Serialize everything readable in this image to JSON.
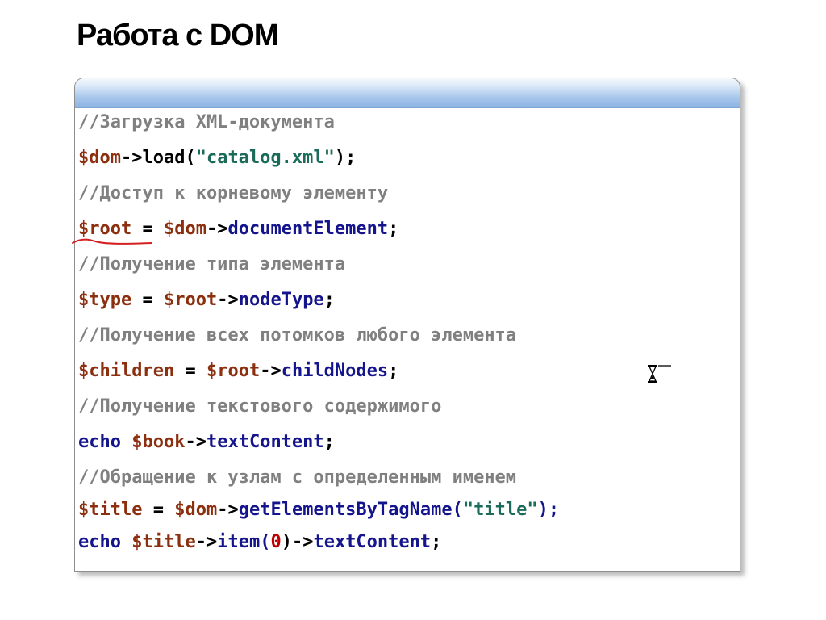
{
  "slide": {
    "title": "Работа с DOM"
  },
  "code": {
    "lines": [
      [
        {
          "t": "//Загрузка XML-документа",
          "k": "cm"
        }
      ],
      [
        {
          "t": "$dom",
          "k": "var"
        },
        {
          "t": "->load(",
          "k": "op"
        },
        {
          "t": "\"catalog.xml\"",
          "k": "str"
        },
        {
          "t": ");",
          "k": "op"
        }
      ],
      [
        {
          "t": "//Доступ к корневому элементу",
          "k": "cm"
        }
      ],
      [
        {
          "t": "$root",
          "k": "var"
        },
        {
          "t": " = ",
          "k": "op"
        },
        {
          "t": "$dom",
          "k": "var"
        },
        {
          "t": "->",
          "k": "op"
        },
        {
          "t": "documentElement",
          "k": "kw"
        },
        {
          "t": ";",
          "k": "op"
        }
      ],
      [
        {
          "t": "//Получение типа элемента",
          "k": "cm"
        }
      ],
      [
        {
          "t": "$type",
          "k": "var"
        },
        {
          "t": " = ",
          "k": "op"
        },
        {
          "t": "$root",
          "k": "var"
        },
        {
          "t": "->",
          "k": "op"
        },
        {
          "t": "nodeType",
          "k": "kw"
        },
        {
          "t": ";",
          "k": "op"
        }
      ],
      [
        {
          "t": "//Получение всех потомков любого элемента",
          "k": "cm"
        }
      ],
      [
        {
          "t": "$children",
          "k": "var"
        },
        {
          "t": " = ",
          "k": "op"
        },
        {
          "t": "$root",
          "k": "var"
        },
        {
          "t": "->",
          "k": "op"
        },
        {
          "t": "childNodes",
          "k": "kw"
        },
        {
          "t": ";",
          "k": "op"
        }
      ],
      [
        {
          "t": "//Получение текстового содержимого",
          "k": "cm"
        }
      ],
      [
        {
          "t": "echo",
          "k": "kw"
        },
        {
          "t": " ",
          "k": "op"
        },
        {
          "t": "$book",
          "k": "var"
        },
        {
          "t": "->",
          "k": "op"
        },
        {
          "t": "textContent",
          "k": "kw"
        },
        {
          "t": ";",
          "k": "op"
        }
      ],
      [
        {
          "t": "//Обращение к узлам с определенным именем",
          "k": "cm"
        }
      ],
      [
        {
          "t": "$title",
          "k": "var"
        },
        {
          "t": " = ",
          "k": "op"
        },
        {
          "t": "$dom",
          "k": "var"
        },
        {
          "t": "->",
          "k": "op"
        },
        {
          "t": "getElementsByTagName(",
          "k": "kw"
        },
        {
          "t": "\"title\"",
          "k": "str"
        },
        {
          "t": ");",
          "k": "kw"
        }
      ],
      [
        {
          "t": "echo",
          "k": "kw"
        },
        {
          "t": " ",
          "k": "op"
        },
        {
          "t": "$title",
          "k": "var"
        },
        {
          "t": "->",
          "k": "op"
        },
        {
          "t": "item(",
          "k": "kw"
        },
        {
          "t": "0",
          "k": "num"
        },
        {
          "t": ")->",
          "k": "op"
        },
        {
          "t": "textContent",
          "k": "kw"
        },
        {
          "t": ";",
          "k": "op"
        }
      ]
    ]
  },
  "annotation": {
    "icon": "red-pen-underline-icon",
    "color": "#d42020"
  },
  "cursor": {
    "icon": "hourglass-cursor-icon"
  },
  "colors": {
    "comment": "#808080",
    "variable": "#8b2f0f",
    "keyword": "#14148c",
    "string": "#1a6b5a",
    "number": "#c00000",
    "header_accent": "#8bb3e2"
  }
}
